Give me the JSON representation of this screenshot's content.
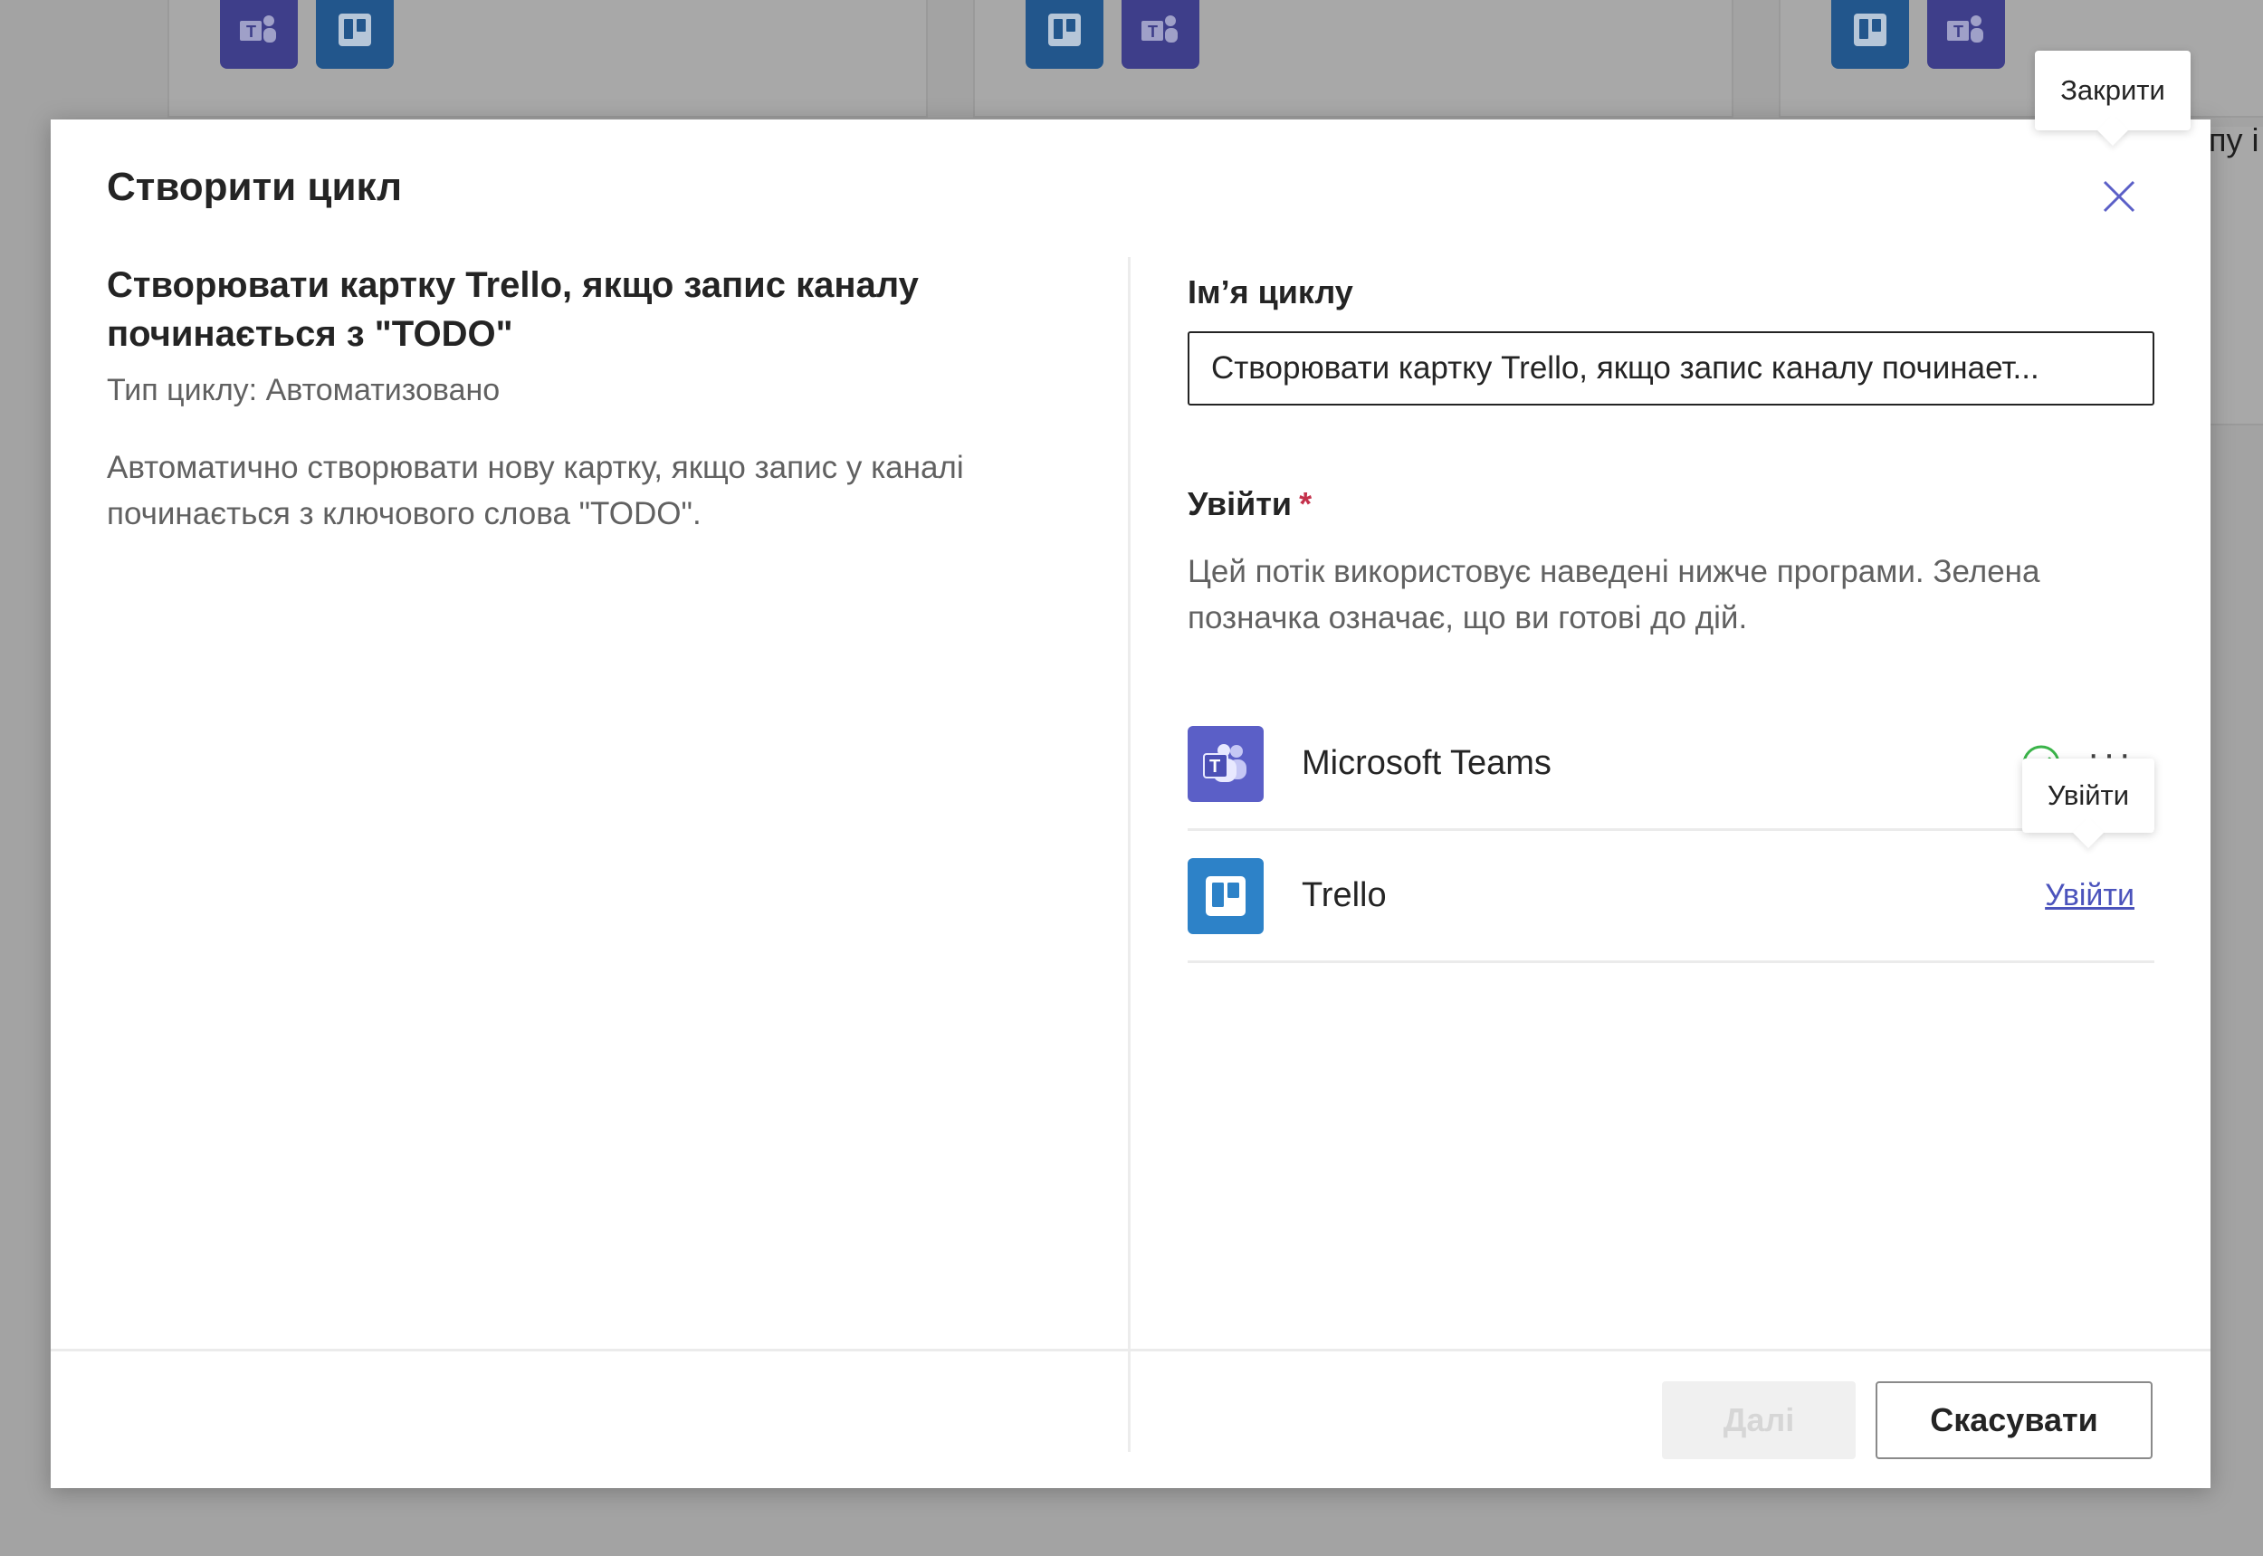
{
  "dialog": {
    "title": "Створити цикл",
    "close_tooltip": "Закрити"
  },
  "template": {
    "heading": "Створювати картку Trello, якщо запис каналу починається з \"TODO\"",
    "type_label": "Тип циклу: Автоматизовано",
    "description": "Автоматично створювати нову картку, якщо запис у каналі починається з ключового слова \"TODO\"."
  },
  "form": {
    "name_label": "Ім’я циклу",
    "name_value": "Створювати картку Trello, якщо запис каналу починает...",
    "signin_label": "Увійти",
    "required_mark": "*",
    "signin_description": "Цей потік використовує наведені нижче програми. Зелена позначка означає, що ви готові до дій."
  },
  "apps": [
    {
      "name": "Microsoft Teams",
      "icon": "teams-icon",
      "status": "connected",
      "more": "···"
    },
    {
      "name": "Trello",
      "icon": "trello-icon",
      "status": "signin",
      "signin_label": "Увійти",
      "tooltip": "Увійти"
    }
  ],
  "footer": {
    "next_label": "Далі",
    "cancel_label": "Скасувати"
  },
  "background": {
    "peek_text": "пу і"
  },
  "colors": {
    "teams": "#5b5fc7",
    "trello": "#2d82c8",
    "link": "#4b53bc",
    "success": "#3bb44a",
    "required": "#c4314b"
  }
}
